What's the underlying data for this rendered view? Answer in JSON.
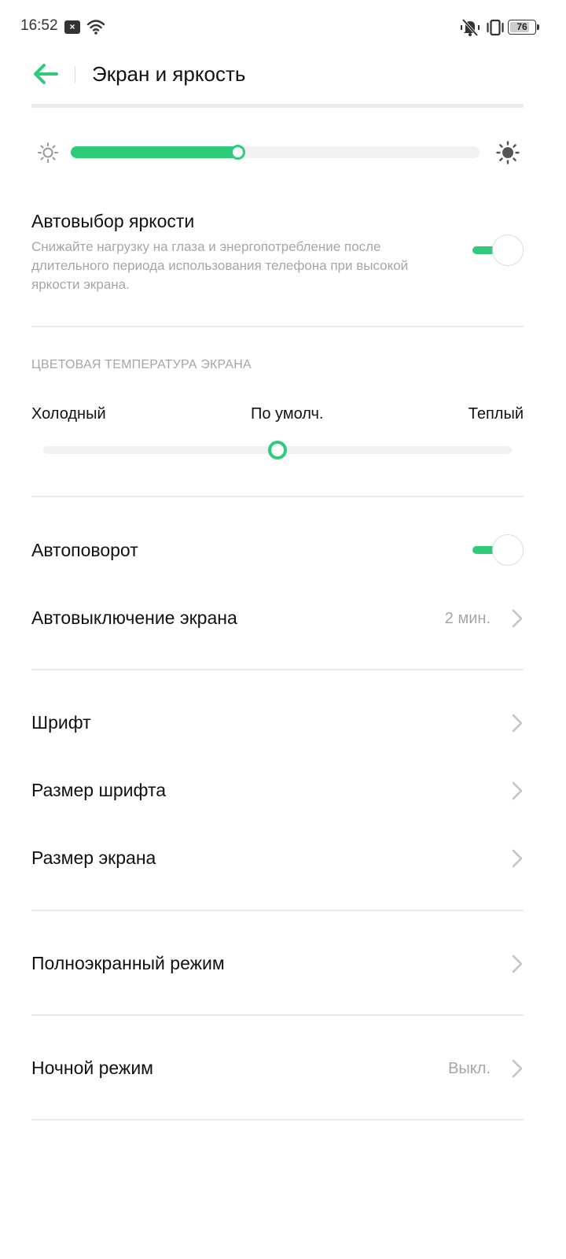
{
  "status_bar": {
    "time": "16:52",
    "battery": "76",
    "icons": [
      "notification-icon",
      "wifi-icon",
      "mute-icon",
      "vibrate-icon",
      "battery-icon"
    ]
  },
  "header": {
    "title": "Экран и яркость",
    "back_icon": "arrow-left-icon"
  },
  "brightness": {
    "level_fraction": 0.41,
    "min_icon": "sun-small-icon",
    "max_icon": "sun-large-icon"
  },
  "auto_brightness": {
    "title": "Автовыбор яркости",
    "description": "Снижайте нагрузку на глаза и энергопотребление после длительного периода использования телефона при высокой яркости экрана.",
    "enabled": true
  },
  "color_temperature": {
    "section_label": "ЦВЕТОВАЯ ТЕМПЕРАТУРА ЭКРАНА",
    "cold_label": "Холодный",
    "default_label": "По умолч.",
    "warm_label": "Теплый",
    "level_fraction": 0.5
  },
  "auto_rotate": {
    "title": "Автоповорот",
    "enabled": true
  },
  "screen_timeout": {
    "title": "Автовыключение экрана",
    "value": "2 мин."
  },
  "font": {
    "title": "Шрифт"
  },
  "font_size": {
    "title": "Размер шрифта"
  },
  "display_size": {
    "title": "Размер экрана"
  },
  "fullscreen": {
    "title": "Полноэкранный режим"
  },
  "night_mode": {
    "title": "Ночной режим",
    "value": "Выкл."
  },
  "colors": {
    "accent": "#2fcb7a",
    "divider": "#e9e9e9",
    "secondary_text": "#a6a6a6"
  }
}
